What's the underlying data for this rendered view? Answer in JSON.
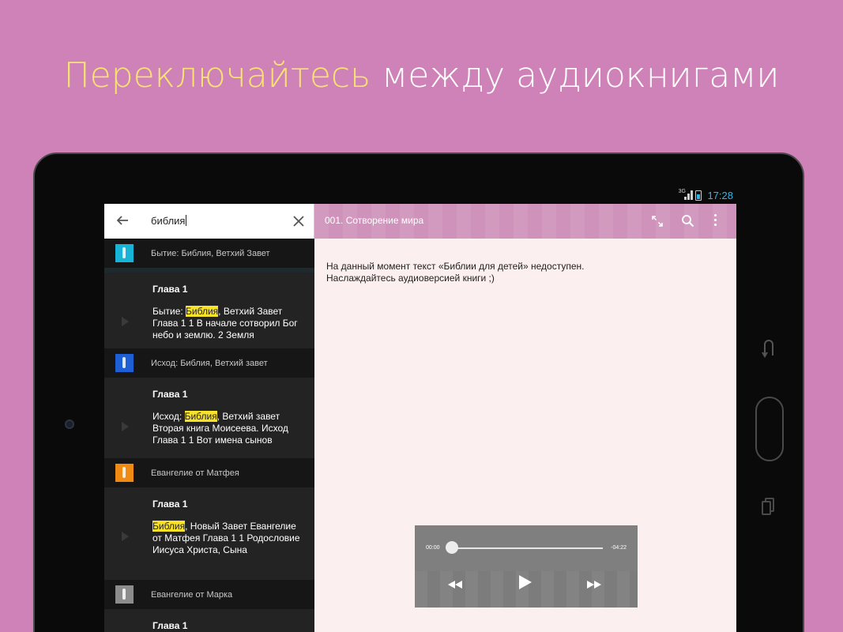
{
  "headline": {
    "accent": "Переключайтесь",
    "rest": " между аудиокнигами"
  },
  "status": {
    "network": "3G",
    "time": "17:28",
    "colors": {
      "clock": "#39b4e6"
    }
  },
  "search": {
    "query": "библия"
  },
  "results": [
    {
      "book": "Бытие: Библия, Ветхий Завет",
      "thumb_color": "#18b4d8",
      "chapter": "Глава 1",
      "snippet_pre": "Бытие: ",
      "snippet_hl": "Библия",
      "snippet_post": ", Ветхий Завет Глава 1 1 В начале сотворил Бог небо и землю. 2 Земля"
    },
    {
      "book": "Исход: Библия, Ветхий завет",
      "thumb_color": "#1e5fd6",
      "chapter": "Глава 1",
      "snippet_pre": "Исход: ",
      "snippet_hl": "Библия",
      "snippet_post": ", Ветхий завет Вторая книга Моисеева. Исход Глава 1 1 Вот имена сынов"
    },
    {
      "book": "Евангелие от Матфея",
      "thumb_color": "#f08a12",
      "chapter": "Глава 1",
      "snippet_pre": "",
      "snippet_hl": "Библия",
      "snippet_post": ", Новый Завет Евангелие от Матфея Глава 1 1 Родословие Иисуса Христа, Сына"
    },
    {
      "book": "Евангелие от Марка",
      "thumb_color": "#8c8c8c",
      "chapter": "Глава 1"
    }
  ],
  "reader": {
    "title": "001. Сотворение мира",
    "notice_line1": "На данный момент текст «Библии для детей» недоступен.",
    "notice_line2": "Наслаждайтесь аудиоверсией книги ;)"
  },
  "player": {
    "elapsed": "00:00",
    "remaining": "-04:22",
    "progress": 0
  },
  "colors": {
    "background": "#cf82b8",
    "highlight": "#f9e22a",
    "appbar": "#d39ac0",
    "accent_headline": "#f9e470"
  }
}
